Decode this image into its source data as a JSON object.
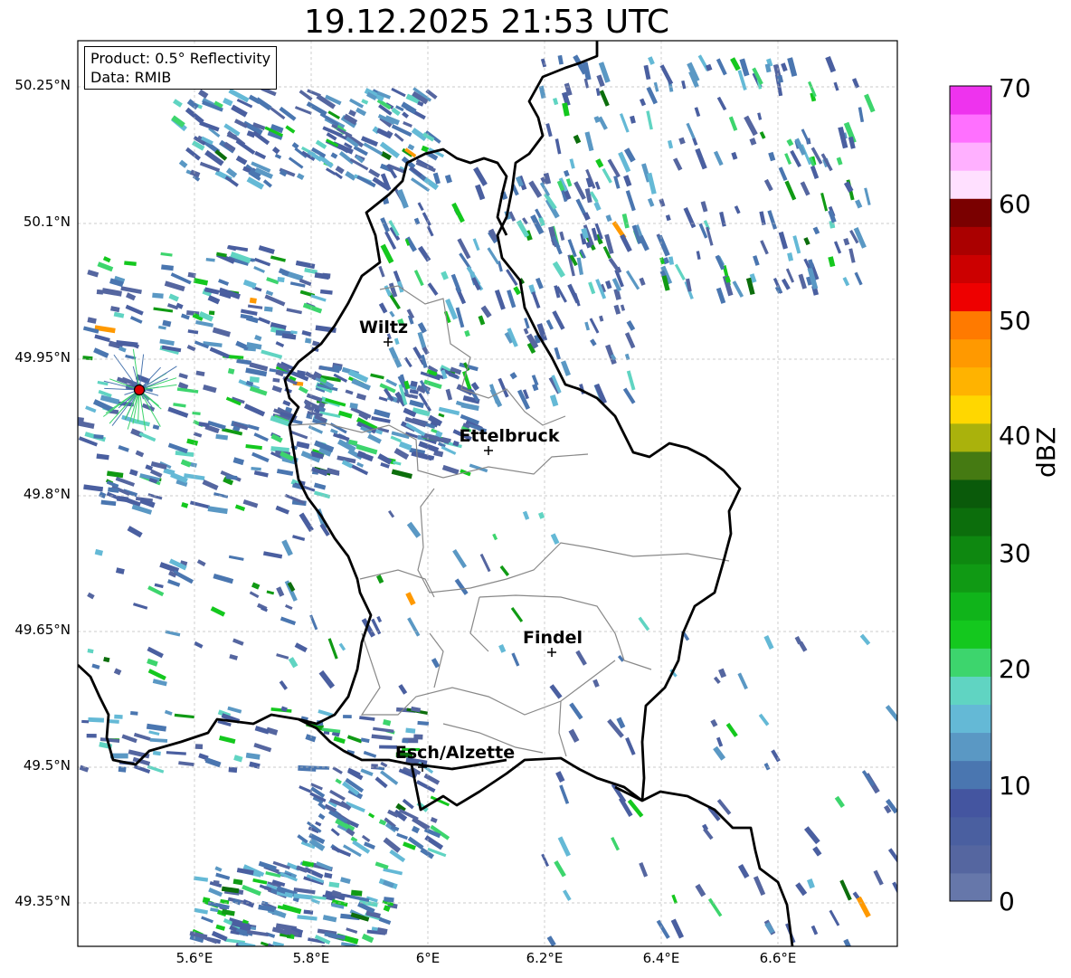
{
  "title": "19.12.2025 21:53 UTC",
  "info_box": {
    "product": "Product: 0.5° Reflectivity",
    "data_source": "Data: RMIB"
  },
  "axes": {
    "y_ticks": [
      "50.25°N",
      "50.1°N",
      "49.95°N",
      "49.8°N",
      "49.65°N",
      "49.5°N",
      "49.35°N"
    ],
    "x_ticks": [
      "5.6°E",
      "5.8°E",
      "6°E",
      "6.2°E",
      "6.4°E",
      "6.6°E"
    ],
    "gridlines": true
  },
  "cities": [
    {
      "name": "Wiltz"
    },
    {
      "name": "Ettelbruck"
    },
    {
      "name": "Findel"
    },
    {
      "name": "Esch/Alzette"
    }
  ],
  "radar_site_color": "#dd0000",
  "colorbar": {
    "label": "dBZ",
    "ticks": [
      "0",
      "10",
      "20",
      "30",
      "40",
      "50",
      "60",
      "70"
    ],
    "range": [
      0,
      70
    ],
    "colors": [
      "#6677aa",
      "#5566a0",
      "#4a5fa0",
      "#4455a0",
      "#4a76b0",
      "#5a98c4",
      "#64b9d6",
      "#60d4c2",
      "#3dd56d",
      "#14c81e",
      "#10b41a",
      "#109a14",
      "#0e8810",
      "#0c6e0c",
      "#0a5a0a",
      "#457a12",
      "#aab20c",
      "#ffd700",
      "#ffb300",
      "#ff9900",
      "#ff7a00",
      "#ee0000",
      "#cc0000",
      "#aa0000",
      "#7a0000",
      "#ffe0ff",
      "#ffb0ff",
      "#ff70ff",
      "#ee33ee"
    ]
  },
  "borders": {
    "country_color": "#000000",
    "canton_color": "#888888"
  }
}
